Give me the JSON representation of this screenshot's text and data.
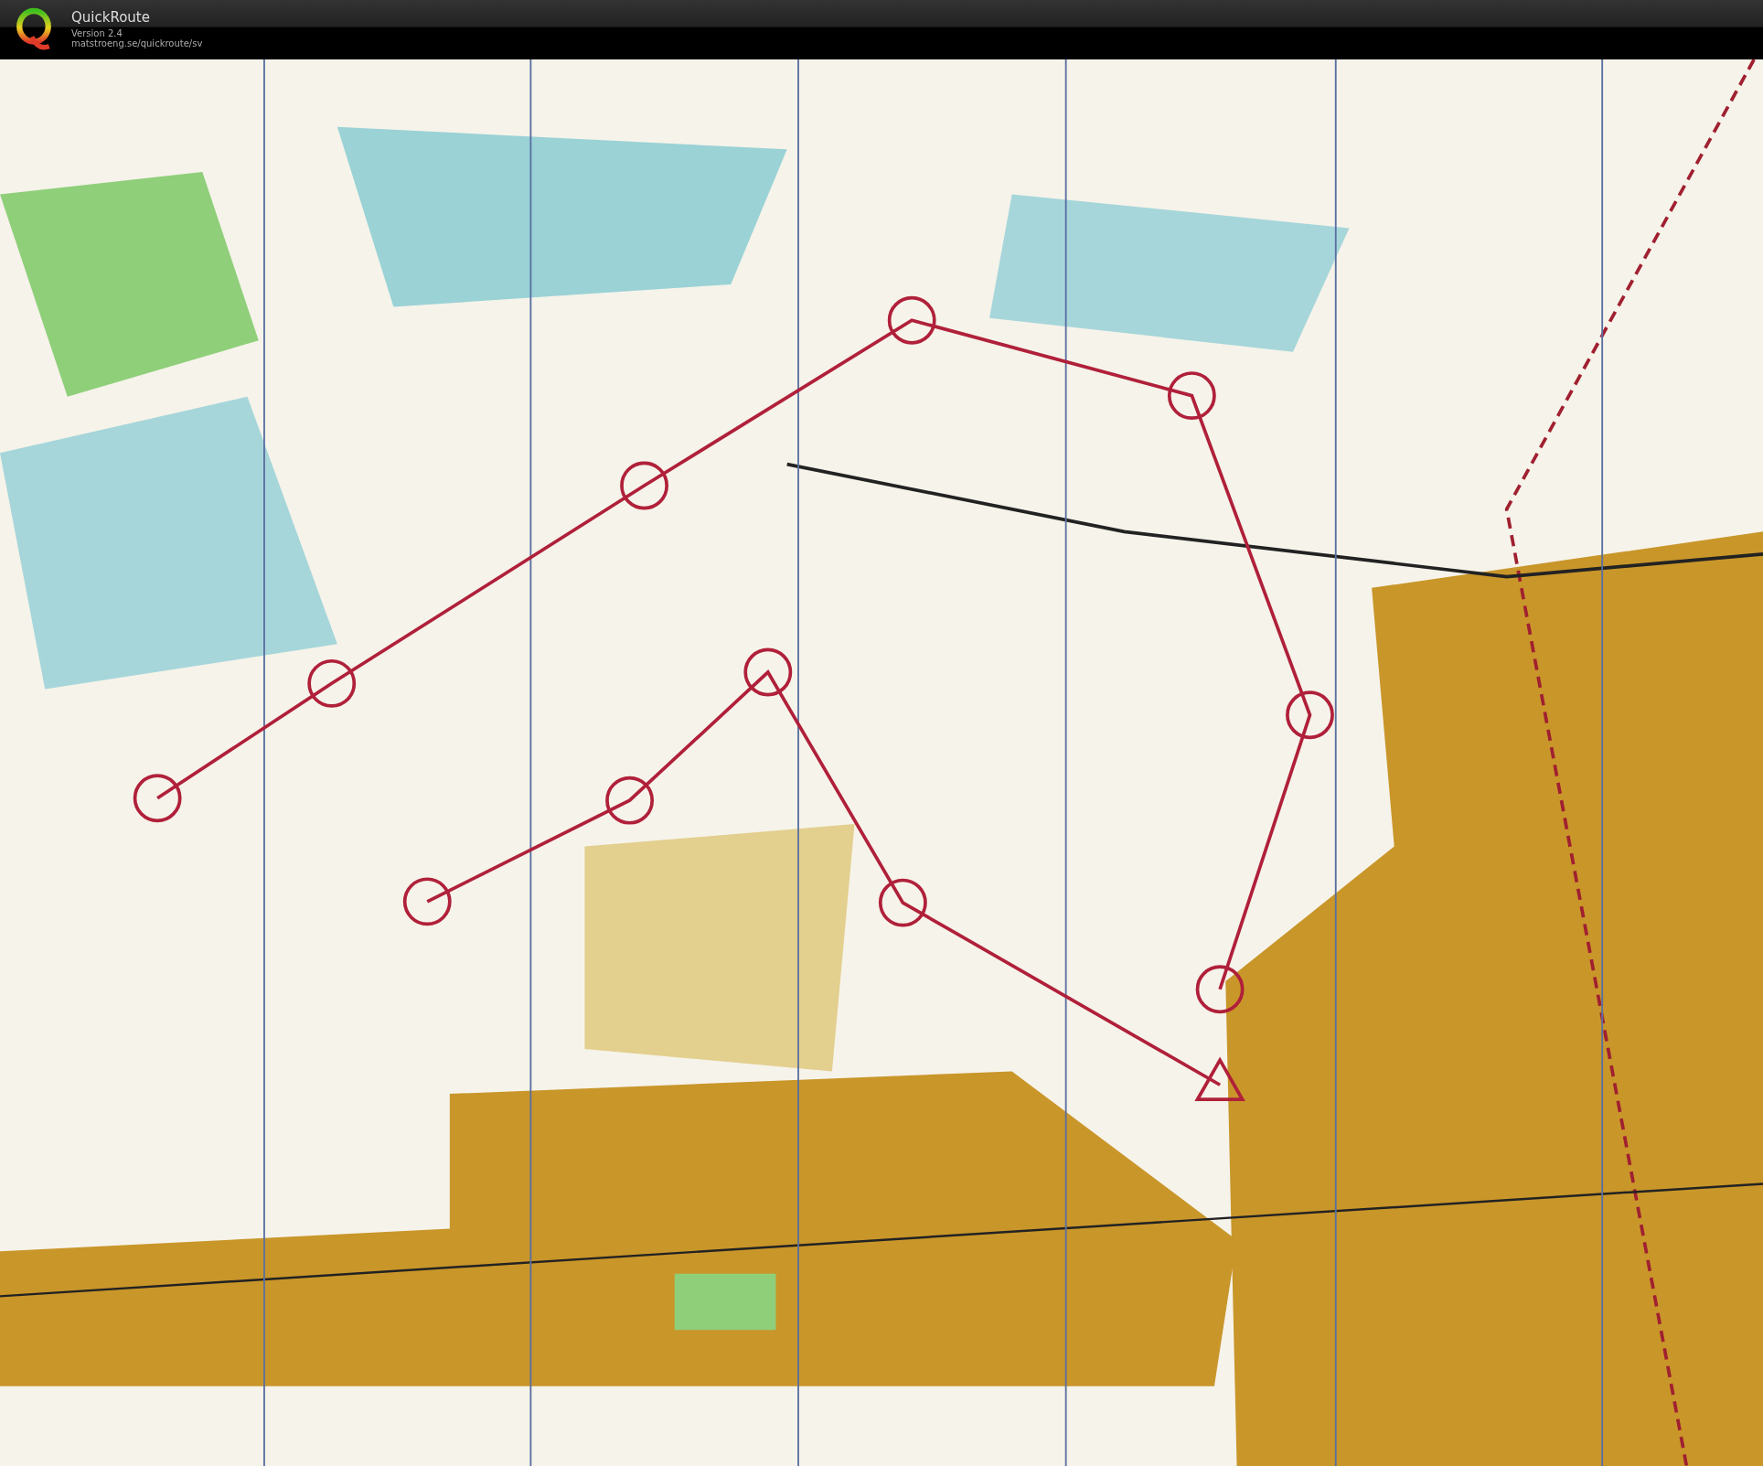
{
  "app": {
    "title": "QuickRoute",
    "version": "Version 2.4",
    "url": "matstroeng.se/quickroute/sv"
  }
}
